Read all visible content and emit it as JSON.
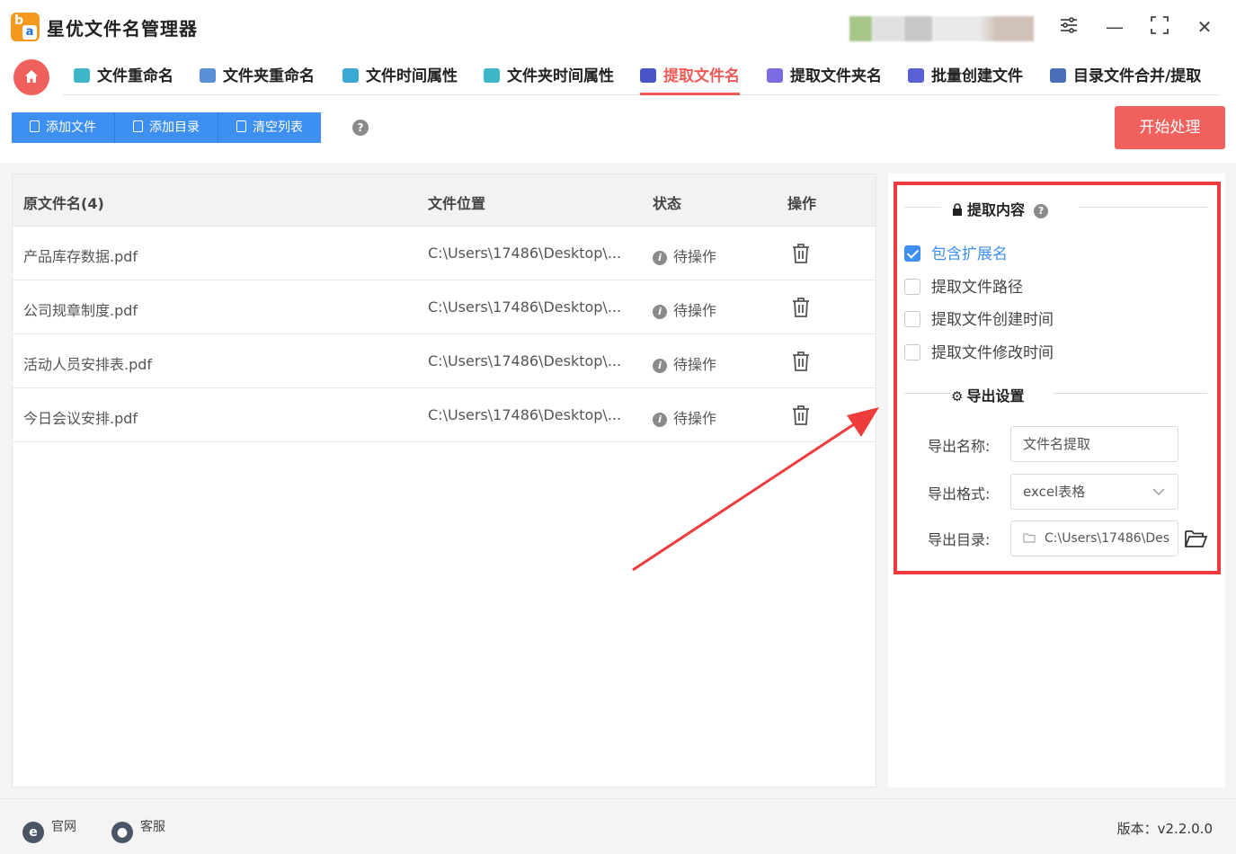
{
  "app": {
    "title": "星优文件名管理器",
    "logo_letters": {
      "b": "b",
      "a": "a"
    }
  },
  "window_controls": {
    "settings": "settings-icon",
    "minimize": "—",
    "maximize": "maximize-icon",
    "close": "✕"
  },
  "nav": {
    "tabs": [
      {
        "label": "文件重命名",
        "icon": "rename-icon",
        "color": "#3fb6c9"
      },
      {
        "label": "文件夹重命名",
        "icon": "folder-rename-icon",
        "color": "#5a8fd8"
      },
      {
        "label": "文件时间属性",
        "icon": "file-time-icon",
        "color": "#3aa9d6"
      },
      {
        "label": "文件夹时间属性",
        "icon": "folder-time-icon",
        "color": "#3eb8c8"
      },
      {
        "label": "提取文件名",
        "icon": "extract-name-icon",
        "color": "#4a55c8",
        "active": true
      },
      {
        "label": "提取文件夹名",
        "icon": "extract-folder-icon",
        "color": "#7a6be0"
      },
      {
        "label": "批量创建文件",
        "icon": "batch-create-icon",
        "color": "#5b5fd6"
      },
      {
        "label": "目录文件合并/提取",
        "icon": "dir-merge-icon",
        "color": "#4a6fb8"
      }
    ]
  },
  "toolbar": {
    "add_file": "添加文件",
    "add_dir": "添加目录",
    "clear_list": "清空列表",
    "help": "?",
    "start": "开始处理"
  },
  "table": {
    "headers": {
      "name": "原文件名(4)",
      "location": "文件位置",
      "status": "状态",
      "action": "操作"
    },
    "rows": [
      {
        "name": "产品库存数据.pdf",
        "location": "C:\\Users\\17486\\Desktop\\...",
        "status": "待操作"
      },
      {
        "name": "公司规章制度.pdf",
        "location": "C:\\Users\\17486\\Desktop\\...",
        "status": "待操作"
      },
      {
        "name": "活动人员安排表.pdf",
        "location": "C:\\Users\\17486\\Desktop\\...",
        "status": "待操作"
      },
      {
        "name": "今日会议安排.pdf",
        "location": "C:\\Users\\17486\\Desktop\\...",
        "status": "待操作"
      }
    ]
  },
  "panel": {
    "extract_title": "提取内容",
    "options": [
      {
        "label": "包含扩展名",
        "checked": true
      },
      {
        "label": "提取文件路径",
        "checked": false
      },
      {
        "label": "提取文件创建时间",
        "checked": false
      },
      {
        "label": "提取文件修改时间",
        "checked": false
      }
    ],
    "export_title": "导出设置",
    "export_name_label": "导出名称:",
    "export_name_value": "文件名提取",
    "export_format_label": "导出格式:",
    "export_format_value": "excel表格",
    "export_dir_label": "导出目录:",
    "export_dir_value": "C:\\Users\\17486\\Des"
  },
  "footer": {
    "website": "官网",
    "service": "客服",
    "version": "版本：v2.2.0.0"
  },
  "colors": {
    "accent": "#f0605c",
    "primary": "#3d8ff2",
    "annotation": "#ee3b3b"
  }
}
